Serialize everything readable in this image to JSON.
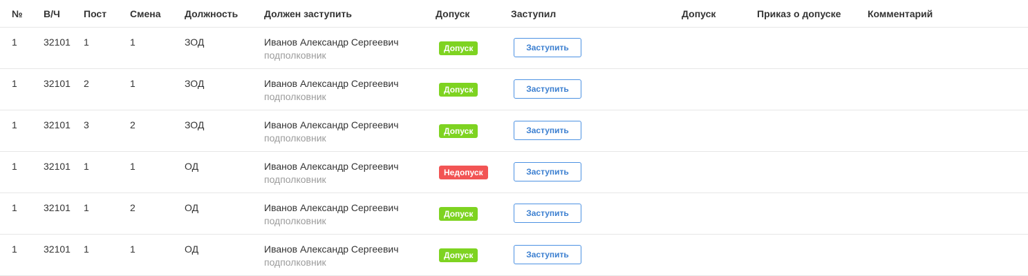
{
  "columns": {
    "num": "№",
    "unit": "В/Ч",
    "post": "Пост",
    "shift": "Смена",
    "position": "Должность",
    "should_arrive": "Должен заступить",
    "admission": "Допуск",
    "arrived": "Заступил",
    "admission2": "Допуск",
    "order": "Приказ о допуске",
    "comment": "Комментарий"
  },
  "colors": {
    "admitted": "#7ed321",
    "not_admitted": "#f25454",
    "button_border": "#4a90e2"
  },
  "rows": [
    {
      "num": "1",
      "unit": "32101",
      "post": "1",
      "shift": "1",
      "position": "ЗОД",
      "name": "Иванов Александр Сергеевич",
      "rank": "подполковник",
      "status": "Допуск",
      "status_type": "admitted",
      "action": "Заступить"
    },
    {
      "num": "1",
      "unit": "32101",
      "post": "2",
      "shift": "1",
      "position": "ЗОД",
      "name": "Иванов Александр Сергеевич",
      "rank": "подполковник",
      "status": "Допуск",
      "status_type": "admitted",
      "action": "Заступить"
    },
    {
      "num": "1",
      "unit": "32101",
      "post": "3",
      "shift": "2",
      "position": "ЗОД",
      "name": "Иванов Александр Сергеевич",
      "rank": "подполковник",
      "status": "Допуск",
      "status_type": "admitted",
      "action": "Заступить"
    },
    {
      "num": "1",
      "unit": "32101",
      "post": "1",
      "shift": "1",
      "position": "ОД",
      "name": "Иванов Александр Сергеевич",
      "rank": "подполковник",
      "status": "Недопуск",
      "status_type": "not_admitted",
      "action": "Заступить"
    },
    {
      "num": "1",
      "unit": "32101",
      "post": "1",
      "shift": "2",
      "position": "ОД",
      "name": "Иванов Александр Сергеевич",
      "rank": "подполковник",
      "status": "Допуск",
      "status_type": "admitted",
      "action": "Заступить"
    },
    {
      "num": "1",
      "unit": "32101",
      "post": "1",
      "shift": "1",
      "position": "ОД",
      "name": "Иванов Александр Сергеевич",
      "rank": "подполковник",
      "status": "Допуск",
      "status_type": "admitted",
      "action": "Заступить"
    }
  ]
}
